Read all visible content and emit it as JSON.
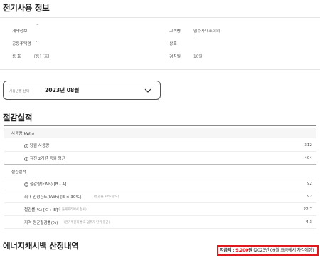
{
  "contract": {
    "title": "전기사용 정보",
    "fields": [
      {
        "label": "계약정보",
        "value": "··"
      },
      {
        "label": "고객명",
        "value": "입주자대표회의"
      },
      {
        "label": "공동주택명",
        "value": "-"
      },
      {
        "label": "상호",
        "value": "-"
      },
      {
        "label": "동·호",
        "value": "[동] [호]"
      },
      {
        "label": "검침일",
        "value": "10일"
      }
    ]
  },
  "month_select": {
    "label": "사용년월 선택",
    "value": "2023년 08월",
    "icon": "chevron-down-icon"
  },
  "savings": {
    "title": "절감실적",
    "usage_section": "사용량(kWh)",
    "usage_rows": [
      {
        "badge": "A",
        "label": "당월 사용량",
        "value": "312"
      },
      {
        "badge": "B",
        "label": "직전 2개년 동월 평균",
        "value": "404"
      }
    ],
    "result_section": "절감실적",
    "result_rows": [
      {
        "badge": "C",
        "label": "절감량(kWh) [B - A]",
        "note": "",
        "value": "92"
      },
      {
        "badge": "",
        "label": "최대 인정한도(kWh) [B × 30%]",
        "note": "(절감률 30% 한도)",
        "value": "92"
      },
      {
        "badge": "",
        "label": "절감률(%) [C ÷ B]",
        "note": "(소수 둘째자리에서 절사)",
        "value": "22.7"
      },
      {
        "badge": "",
        "label": "지역 평균절감률(%)",
        "note": "(전기위원회 발표 입주자 단위 평균)",
        "value": "4.3"
      }
    ]
  },
  "cashback": {
    "title": "에너지캐시백 산정내역",
    "notice_prefix": "지급액 : ",
    "amount": "9,200",
    "unit": "원",
    "notice_suffix": " (2023년 09월 요금에서 차감예정)"
  },
  "colors": {
    "accent_red": "#e0191f",
    "band": "#f6f6f6"
  }
}
